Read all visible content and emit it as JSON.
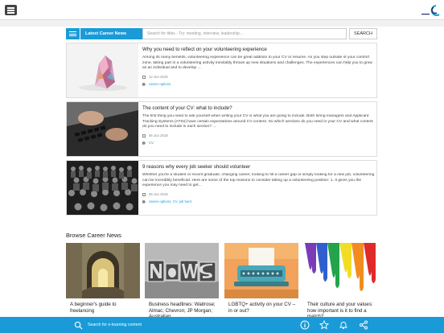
{
  "header": {
    "menu_icon": "hamburger-icon",
    "logo_icon": "brand-logo-icon"
  },
  "toolbar": {
    "latest_label": "Latest Career News",
    "search_placeholder": "Search for titles - Try: meeting, interview, leadership...",
    "search_button": "SEARCH"
  },
  "articles": [
    {
      "title": "Why you need to reflect on your volunteering experience",
      "excerpt": "Among its many benefits, volunteering experience can be great addition to your CV or resume. As you step outside of your comfort zone, taking part in a volunteering activity inevitably throws up new situations and challenges. The experiences can help you to grow as an individual and to develop ...",
      "date": "12 Jun 2019",
      "tags": "career options"
    },
    {
      "title": "The content of your CV: what to include?",
      "excerpt": "The first thing you need to ask yourself when writing your CV is what you are going to include. Both hiring managers and Applicant Tracking Systems (ATSs) have certain expectations around CV content. So which sections do you need in your CV and what content do you need to include in each section? ...",
      "date": "06 Jun 2019",
      "tags": "CV"
    },
    {
      "title": "9 reasons why every job seeker should volunteer",
      "excerpt": "Whether you're a student or recent graduate, changing career, looking to fill a career gap or simply looking for a new job, volunteering can be incredibly beneficial. Here are some of the top reasons to consider taking up a volunteering position: 1. It gives you the experience you may need to get...",
      "date": "06 Jun 2019",
      "tags": "career options, CV, job hunt"
    }
  ],
  "browse": {
    "title": "Browse Career News",
    "cards": [
      {
        "title": "A beginner's guide to freelancing"
      },
      {
        "title": "Business headlines: Waitrose; Almac; Chevron; JP Morgan; Australian"
      },
      {
        "title": "LGBTQ+ activity on your CV – in or out?"
      },
      {
        "title": "Their culture and your values: how important is it to find a match?"
      }
    ]
  },
  "bottom_bar": {
    "search_text": "Search for e-learning content",
    "icons": [
      "search-icon",
      "info-icon",
      "star-icon",
      "bell-icon",
      "share-icon"
    ]
  },
  "colors": {
    "accent": "#1a9bd7"
  }
}
